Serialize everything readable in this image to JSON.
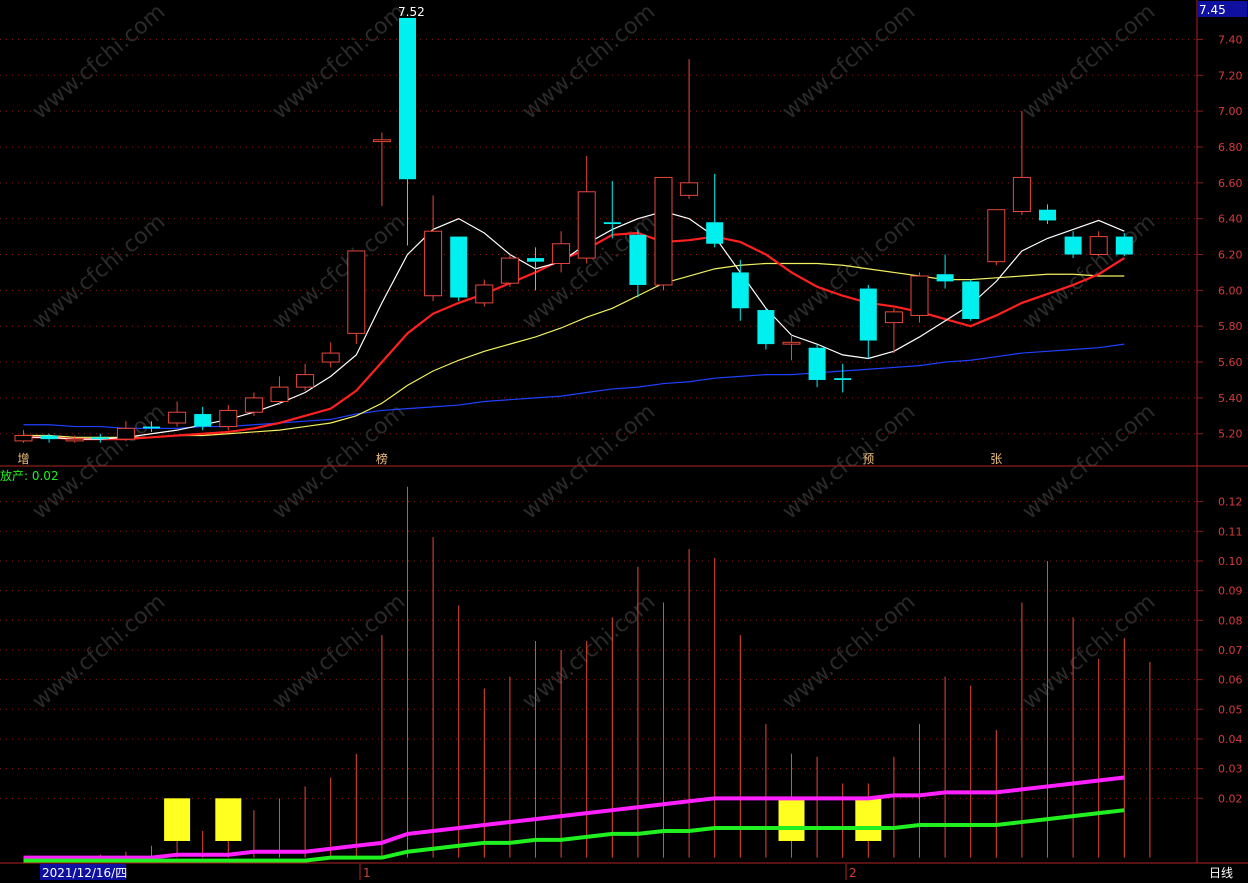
{
  "colors": {
    "background": "#000000",
    "grid": "#8b1a1a",
    "up": "#e8473c",
    "down": "#00f0f0",
    "ma5": "#ffffff",
    "ma10": "#ff2020",
    "ma20": "#f0f060",
    "ma60": "#2040ff",
    "axis_text": "#d43c3c",
    "vol_magenta": "#ff20ff",
    "vol_green": "#20f020",
    "highlight": "#ffff20"
  },
  "header": {
    "price_box": "7.45",
    "period_label": "日线",
    "indicator_label": "放产: 0.02",
    "high_marker": "7.52",
    "date_label": "2021/12/16/四",
    "month_marks": [
      "1",
      "2"
    ]
  },
  "signal_markers": [
    {
      "label": "增",
      "index": 0
    },
    {
      "label": "榜",
      "index": 14
    },
    {
      "label": "预",
      "index": 33
    },
    {
      "label": "张",
      "index": 38
    }
  ],
  "watermark_text": "www.cfchi.com",
  "chart_data": [
    {
      "type": "candlestick",
      "title": "",
      "y_ticks": [
        "7.40",
        "7.20",
        "7.00",
        "6.80",
        "6.60",
        "6.40",
        "6.20",
        "6.00",
        "5.80",
        "5.60",
        "5.40",
        "5.20"
      ],
      "ylim": [
        5.02,
        7.62
      ],
      "candles": [
        {
          "o": 5.16,
          "c": 5.19,
          "h": 5.22,
          "l": 5.15
        },
        {
          "o": 5.19,
          "c": 5.17,
          "h": 5.2,
          "l": 5.15
        },
        {
          "o": 5.16,
          "c": 5.17,
          "h": 5.19,
          "l": 5.15
        },
        {
          "o": 5.18,
          "c": 5.17,
          "h": 5.2,
          "l": 5.15
        },
        {
          "o": 5.17,
          "c": 5.23,
          "h": 5.27,
          "l": 5.16
        },
        {
          "o": 5.24,
          "c": 5.23,
          "h": 5.27,
          "l": 5.21
        },
        {
          "o": 5.26,
          "c": 5.32,
          "h": 5.38,
          "l": 5.24
        },
        {
          "o": 5.31,
          "c": 5.24,
          "h": 5.35,
          "l": 5.22
        },
        {
          "o": 5.24,
          "c": 5.33,
          "h": 5.36,
          "l": 5.22
        },
        {
          "o": 5.32,
          "c": 5.4,
          "h": 5.43,
          "l": 5.3
        },
        {
          "o": 5.38,
          "c": 5.46,
          "h": 5.52,
          "l": 5.36
        },
        {
          "o": 5.46,
          "c": 5.53,
          "h": 5.59,
          "l": 5.44
        },
        {
          "o": 5.6,
          "c": 5.65,
          "h": 5.71,
          "l": 5.57
        },
        {
          "o": 5.76,
          "c": 6.22,
          "h": 6.22,
          "l": 5.7
        },
        {
          "o": 6.83,
          "c": 6.84,
          "h": 6.88,
          "l": 6.47
        },
        {
          "o": 7.52,
          "c": 6.62,
          "h": 7.52,
          "l": 6.25
        },
        {
          "o": 5.97,
          "c": 6.33,
          "h": 6.53,
          "l": 5.94
        },
        {
          "o": 6.3,
          "c": 5.96,
          "h": 6.3,
          "l": 5.94
        },
        {
          "o": 5.93,
          "c": 6.03,
          "h": 6.06,
          "l": 5.91
        },
        {
          "o": 6.04,
          "c": 6.18,
          "h": 6.2,
          "l": 6.02
        },
        {
          "o": 6.18,
          "c": 6.16,
          "h": 6.24,
          "l": 6.0
        },
        {
          "o": 6.15,
          "c": 6.26,
          "h": 6.33,
          "l": 6.1
        },
        {
          "o": 6.18,
          "c": 6.55,
          "h": 6.75,
          "l": 6.15
        },
        {
          "o": 6.38,
          "c": 6.37,
          "h": 6.61,
          "l": 6.29
        },
        {
          "o": 6.31,
          "c": 6.03,
          "h": 6.34,
          "l": 5.96
        },
        {
          "o": 6.03,
          "c": 6.63,
          "h": 6.63,
          "l": 6.0
        },
        {
          "o": 6.53,
          "c": 6.6,
          "h": 7.29,
          "l": 6.51
        },
        {
          "o": 6.38,
          "c": 6.26,
          "h": 6.65,
          "l": 6.24
        },
        {
          "o": 6.1,
          "c": 5.9,
          "h": 6.17,
          "l": 5.83
        },
        {
          "o": 5.89,
          "c": 5.7,
          "h": 5.9,
          "l": 5.67
        },
        {
          "o": 5.7,
          "c": 5.71,
          "h": 5.75,
          "l": 5.61
        },
        {
          "o": 5.68,
          "c": 5.5,
          "h": 5.7,
          "l": 5.46
        },
        {
          "o": 5.51,
          "c": 5.5,
          "h": 5.59,
          "l": 5.43
        },
        {
          "o": 6.01,
          "c": 5.72,
          "h": 6.03,
          "l": 5.62
        },
        {
          "o": 5.82,
          "c": 5.88,
          "h": 5.9,
          "l": 5.65
        },
        {
          "o": 5.86,
          "c": 6.08,
          "h": 6.1,
          "l": 5.82
        },
        {
          "o": 6.09,
          "c": 6.05,
          "h": 6.2,
          "l": 6.01
        },
        {
          "o": 6.05,
          "c": 5.84,
          "h": 6.06,
          "l": 5.83
        },
        {
          "o": 6.16,
          "c": 6.45,
          "h": 6.45,
          "l": 6.14
        },
        {
          "o": 6.44,
          "c": 6.63,
          "h": 7.0,
          "l": 6.42
        },
        {
          "o": 6.45,
          "c": 6.39,
          "h": 6.48,
          "l": 6.37
        },
        {
          "o": 6.3,
          "c": 6.2,
          "h": 6.33,
          "l": 6.18
        },
        {
          "o": 6.2,
          "c": 6.3,
          "h": 6.33,
          "l": 6.19
        },
        {
          "o": 6.3,
          "c": 6.2,
          "h": 6.32,
          "l": 6.19
        }
      ],
      "ma5": [
        5.18,
        5.18,
        5.17,
        5.17,
        5.18,
        5.2,
        5.22,
        5.25,
        5.28,
        5.32,
        5.37,
        5.43,
        5.52,
        5.64,
        5.93,
        6.2,
        6.34,
        6.4,
        6.32,
        6.2,
        6.12,
        6.16,
        6.26,
        6.34,
        6.4,
        6.44,
        6.4,
        6.3,
        6.1,
        5.9,
        5.75,
        5.7,
        5.64,
        5.62,
        5.66,
        5.74,
        5.83,
        5.92,
        6.05,
        6.22,
        6.29,
        6.34,
        6.39,
        6.33
      ],
      "ma10": [
        5.18,
        5.18,
        5.17,
        5.17,
        5.17,
        5.18,
        5.19,
        5.2,
        5.21,
        5.23,
        5.26,
        5.3,
        5.34,
        5.44,
        5.6,
        5.76,
        5.87,
        5.93,
        5.98,
        6.04,
        6.1,
        6.17,
        6.23,
        6.31,
        6.32,
        6.27,
        6.28,
        6.3,
        6.27,
        6.2,
        6.1,
        6.02,
        5.97,
        5.93,
        5.91,
        5.88,
        5.84,
        5.8,
        5.86,
        5.93,
        5.98,
        6.03,
        6.09,
        6.18
      ],
      "ma20": [
        5.19,
        5.19,
        5.18,
        5.18,
        5.18,
        5.18,
        5.19,
        5.19,
        5.2,
        5.21,
        5.22,
        5.24,
        5.26,
        5.3,
        5.37,
        5.47,
        5.55,
        5.61,
        5.66,
        5.7,
        5.74,
        5.79,
        5.85,
        5.9,
        5.97,
        6.04,
        6.08,
        6.12,
        6.14,
        6.15,
        6.15,
        6.15,
        6.14,
        6.12,
        6.1,
        6.08,
        6.06,
        6.06,
        6.07,
        6.08,
        6.09,
        6.09,
        6.08,
        6.08
      ],
      "ma60": [
        5.25,
        5.25,
        5.24,
        5.24,
        5.23,
        5.23,
        5.23,
        5.24,
        5.24,
        5.25,
        5.26,
        5.27,
        5.28,
        5.31,
        5.33,
        5.34,
        5.35,
        5.36,
        5.38,
        5.39,
        5.4,
        5.41,
        5.43,
        5.45,
        5.46,
        5.48,
        5.49,
        5.51,
        5.52,
        5.53,
        5.53,
        5.54,
        5.55,
        5.56,
        5.57,
        5.58,
        5.6,
        5.61,
        5.63,
        5.65,
        5.66,
        5.67,
        5.68,
        5.7
      ]
    },
    {
      "type": "bar",
      "title": "放产",
      "y_ticks": [
        "0.12",
        "0.11",
        "0.10",
        "0.09",
        "0.08",
        "0.07",
        "0.06",
        "0.05",
        "0.04",
        "0.03",
        "0.02"
      ],
      "ylim": [
        -0.0018,
        0.132
      ],
      "values": [
        0.0,
        0.0,
        0.0,
        0.001,
        0.002,
        0.004,
        0.007,
        0.009,
        0.01,
        0.016,
        0.02,
        0.024,
        0.027,
        0.035,
        0.075,
        0.125,
        0.108,
        0.085,
        0.057,
        0.061,
        0.073,
        0.07,
        0.073,
        0.081,
        0.098,
        0.086,
        0.104,
        0.101,
        0.075,
        0.045,
        0.035,
        0.034,
        0.025,
        0.025,
        0.034,
        0.045,
        0.061,
        0.058,
        0.043,
        0.086,
        0.1,
        0.081,
        0.067,
        0.074,
        0.066
      ],
      "highlight_bars": [
        {
          "index": 6,
          "value": 0.02
        },
        {
          "index": 8,
          "value": 0.02
        },
        {
          "index": 30,
          "value": 0.02
        },
        {
          "index": 33,
          "value": 0.02
        }
      ],
      "series_magenta": [
        0.0,
        0.0,
        0.0,
        0.0,
        0.0,
        0.0,
        0.001,
        0.001,
        0.001,
        0.002,
        0.002,
        0.002,
        0.003,
        0.004,
        0.005,
        0.008,
        0.009,
        0.01,
        0.011,
        0.012,
        0.013,
        0.014,
        0.015,
        0.016,
        0.017,
        0.018,
        0.019,
        0.02,
        0.02,
        0.02,
        0.02,
        0.02,
        0.02,
        0.02,
        0.021,
        0.021,
        0.022,
        0.022,
        0.022,
        0.023,
        0.024,
        0.025,
        0.026,
        0.027
      ],
      "series_green": [
        -0.001,
        -0.001,
        -0.001,
        -0.001,
        -0.001,
        -0.001,
        -0.001,
        -0.001,
        -0.001,
        -0.001,
        -0.001,
        -0.001,
        0.0,
        0.0,
        0.0,
        0.002,
        0.003,
        0.004,
        0.005,
        0.005,
        0.006,
        0.006,
        0.007,
        0.008,
        0.008,
        0.009,
        0.009,
        0.01,
        0.01,
        0.01,
        0.01,
        0.01,
        0.01,
        0.01,
        0.01,
        0.011,
        0.011,
        0.011,
        0.011,
        0.012,
        0.013,
        0.014,
        0.015,
        0.016
      ]
    }
  ]
}
